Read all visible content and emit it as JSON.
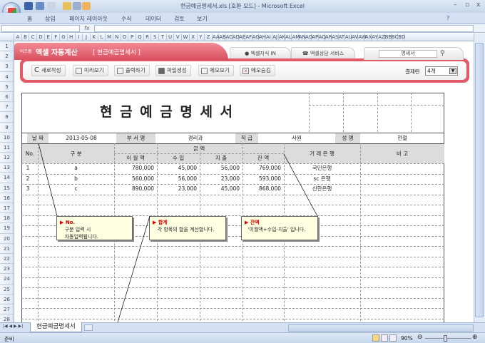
{
  "window": {
    "title": "현금예금명세서.xls  [호환 모드] - Microsoft Excel",
    "min": "–",
    "max": "▫",
    "close": "x"
  },
  "ribbon": {
    "tabs": [
      "홈",
      "삽입",
      "페이지 레이아웃",
      "수식",
      "데이터",
      "검토",
      "보기"
    ],
    "help": "?"
  },
  "formula": {
    "fx": "fx"
  },
  "columns": [
    "A",
    "B",
    "C",
    "D",
    "E",
    "F",
    "G",
    "H",
    "I",
    "J",
    "K",
    "L",
    "M",
    "N",
    "O",
    "P",
    "Q",
    "R",
    "S",
    "T",
    "U",
    "V",
    "W",
    "X",
    "Y",
    "Z",
    "AA",
    "AB",
    "AC",
    "AD",
    "AE",
    "AF",
    "AG",
    "AH",
    "AI",
    "AJ",
    "AK",
    "AL",
    "AM",
    "AN",
    "AO",
    "AP",
    "AQ",
    "AR",
    "AS",
    "AT",
    "AU",
    "AV",
    "AW",
    "AX",
    "AY",
    "AZ",
    "BB",
    "BC",
    "BD"
  ],
  "rows": [
    "1",
    "2",
    "3",
    "4",
    "5",
    "6",
    "7",
    "8",
    "9",
    "10",
    "11",
    "12",
    "13",
    "14",
    "15",
    "16",
    "17",
    "18",
    "19",
    "20",
    "21",
    "22",
    "23",
    "24",
    "25",
    "26",
    "27",
    "28"
  ],
  "panel": {
    "brand_small": "비즈폼",
    "brand": "엑셀 자동계산",
    "form_name": "[ 현금예금명세서 ]",
    "tab1": "엑셀지식 IN",
    "tab2": "엑셀상담 서비스",
    "search_value": "명세서",
    "buttons": [
      "새로작성",
      "미리보기",
      "출력하기",
      "파일생성",
      "메모보기",
      "메모숨김"
    ],
    "approval_label": "결재란",
    "approval_value": "4개"
  },
  "form": {
    "title": "현 금 예 금 명 세 서",
    "date_label": "날 짜",
    "date": "2013-05-08",
    "dept_label": "부 서 명",
    "dept": "경리과",
    "rank_label": "직 급",
    "rank": "사원",
    "name_label": "성 명",
    "name": "현철",
    "headers": {
      "no": "No.",
      "category": "구          분",
      "amount": "금                    액",
      "carry": "이 월 액",
      "income": "수     입",
      "expense": "지     출",
      "balance": "잔     액",
      "bank": "거    래    은    행",
      "note": "비          고"
    },
    "rows": [
      {
        "no": "1",
        "category": "a",
        "carry": "780,000",
        "income": "45,000",
        "expense": "56,000",
        "balance": "769,000",
        "bank": "국민은행"
      },
      {
        "no": "2",
        "category": "b",
        "carry": "560,000",
        "income": "56,000",
        "expense": "23,000",
        "balance": "593,000",
        "bank": "sc 은행"
      },
      {
        "no": "3",
        "category": "c",
        "carry": "890,000",
        "income": "23,000",
        "expense": "45,000",
        "balance": "868,000",
        "bank": "신한은행"
      }
    ]
  },
  "notes": [
    {
      "title": "No.",
      "text1": "구분 입력 시",
      "text2": "자동입력됩니다."
    },
    {
      "title": "합계",
      "text1": "각 항목의 합을 계산합니다."
    },
    {
      "title": "잔액",
      "text1": "'이월액+수입-지출' 입니다."
    }
  ],
  "sheet_tab": "현금예금명세서",
  "status": {
    "ready": "준비",
    "zoom": "90%"
  }
}
